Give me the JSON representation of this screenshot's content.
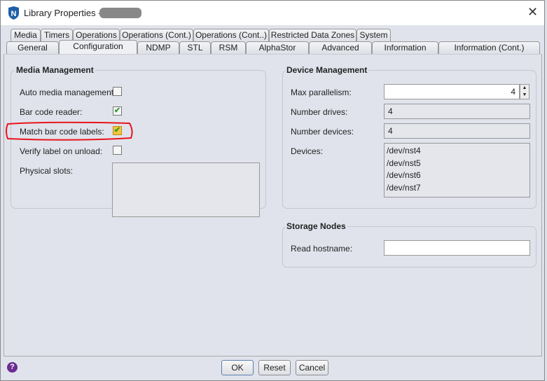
{
  "window": {
    "title": "Library Properties -",
    "close": "✕"
  },
  "tabs_row1": [
    "Media",
    "Timers",
    "Operations",
    "Operations (Cont.)",
    "Operations (Cont..)",
    "Restricted Data Zones",
    "System"
  ],
  "tabs_row2": [
    "General",
    "Configuration",
    "NDMP",
    "STL",
    "RSM",
    "AlphaStor",
    "Advanced",
    "Information",
    "Information (Cont.)"
  ],
  "selected_tab": "Configuration",
  "media_management": {
    "title": "Media Management",
    "auto_media": {
      "label": "Auto media management:",
      "checked": false
    },
    "bar_code_reader": {
      "label": "Bar code reader:",
      "checked": true,
      "mark": "✔"
    },
    "match_bar_code": {
      "label": "Match bar code labels:",
      "checked": true,
      "mark": "✔"
    },
    "verify_label": {
      "label": "Verify label on unload:",
      "checked": false
    },
    "physical_slots": {
      "label": "Physical slots:",
      "value": ""
    }
  },
  "device_management": {
    "title": "Device Management",
    "max_parallelism": {
      "label": "Max parallelism:",
      "value": "4"
    },
    "number_drives": {
      "label": "Number drives:",
      "value": "4"
    },
    "number_devices": {
      "label": "Number devices:",
      "value": "4"
    },
    "devices": {
      "label": "Devices:",
      "items": [
        "/dev/nst4",
        "/dev/nst5",
        "/dev/nst6",
        "/dev/nst7"
      ]
    }
  },
  "storage_nodes": {
    "title": "Storage Nodes",
    "read_hostname": {
      "label": "Read hostname:",
      "value": ""
    }
  },
  "buttons": {
    "ok": "OK",
    "reset": "Reset",
    "cancel": "Cancel",
    "help": "?"
  }
}
